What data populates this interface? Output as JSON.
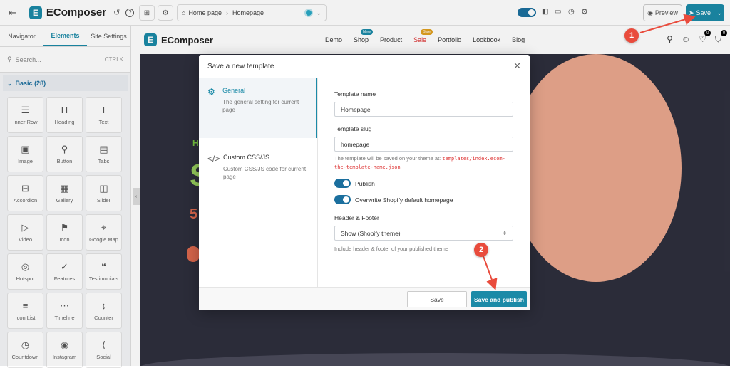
{
  "topbar": {
    "app_name": "EComposer",
    "breadcrumb": [
      "Home page",
      "Homepage"
    ],
    "preview_label": "Preview",
    "save_label": "Save"
  },
  "sidebar": {
    "tabs": [
      "Navigator",
      "Elements",
      "Site Settings"
    ],
    "search_placeholder": "Search...",
    "search_shortcut": "CTRLK",
    "section_title": "Basic (28)",
    "elements": [
      {
        "label": "Inner Row",
        "icon": "inner-row-icon",
        "glyph": "☰"
      },
      {
        "label": "Heading",
        "icon": "heading-icon",
        "glyph": "H"
      },
      {
        "label": "Text",
        "icon": "text-icon",
        "glyph": "T"
      },
      {
        "label": "Image",
        "icon": "image-icon",
        "glyph": "▣"
      },
      {
        "label": "Button",
        "icon": "button-icon",
        "glyph": "⚲"
      },
      {
        "label": "Tabs",
        "icon": "tabs-icon",
        "glyph": "▤"
      },
      {
        "label": "Accordion",
        "icon": "accordion-icon",
        "glyph": "⊟"
      },
      {
        "label": "Gallery",
        "icon": "gallery-icon",
        "glyph": "▦"
      },
      {
        "label": "Slider",
        "icon": "slider-icon",
        "glyph": "◫"
      },
      {
        "label": "Video",
        "icon": "video-icon",
        "glyph": "▷"
      },
      {
        "label": "Icon",
        "icon": "flag-icon",
        "glyph": "⚑"
      },
      {
        "label": "Google Map",
        "icon": "map-icon",
        "glyph": "⌖"
      },
      {
        "label": "Hotspot",
        "icon": "hotspot-icon",
        "glyph": "◎"
      },
      {
        "label": "Features",
        "icon": "features-icon",
        "glyph": "✓"
      },
      {
        "label": "Testimonials",
        "icon": "testimonials-icon",
        "glyph": "❝"
      },
      {
        "label": "Icon List",
        "icon": "icon-list-icon",
        "glyph": "≡"
      },
      {
        "label": "Timeline",
        "icon": "timeline-icon",
        "glyph": "⋯"
      },
      {
        "label": "Counter",
        "icon": "counter-icon",
        "glyph": "↕"
      },
      {
        "label": "Countdown",
        "icon": "countdown-icon",
        "glyph": "◷"
      },
      {
        "label": "Instagram",
        "icon": "instagram-icon",
        "glyph": "◉"
      },
      {
        "label": "Social",
        "icon": "social-icon",
        "glyph": "⟨"
      }
    ]
  },
  "site": {
    "brand": "EComposer",
    "nav": [
      {
        "label": "Demo",
        "badge": ""
      },
      {
        "label": "Shop",
        "badge": "New"
      },
      {
        "label": "Product",
        "badge": ""
      },
      {
        "label": "Sale",
        "badge": "Sale"
      },
      {
        "label": "Portfolio",
        "badge": ""
      },
      {
        "label": "Lookbook",
        "badge": ""
      },
      {
        "label": "Blog",
        "badge": ""
      }
    ],
    "cart_count": "0",
    "wishlist_count": "0",
    "hero_line1": "H",
    "hero_line2": "S",
    "hero_line3": "5"
  },
  "modal": {
    "title": "Save a new template",
    "nav": [
      {
        "title": "General",
        "desc": "The general setting for current page"
      },
      {
        "title": "Custom CSS/JS",
        "desc": "Custom CSS/JS code for current page"
      }
    ],
    "template_name_label": "Template name",
    "template_name_value": "Homepage",
    "template_slug_label": "Template slug",
    "template_slug_value": "homepage",
    "hint_prefix": "The template will be saved on your theme at: ",
    "hint_path": "templates/index.ecom-the-template-name.json",
    "publish_label": "Publish",
    "overwrite_label": "Overwrite Shopify default homepage",
    "header_footer_label": "Header & Footer",
    "header_footer_value": "Show (Shopify theme)",
    "header_footer_hint": "Include header & footer of your published theme",
    "save_button": "Save",
    "publish_button": "Save and publish"
  },
  "annotations": {
    "marker1": "1",
    "marker2": "2",
    "color": "#e94b3c"
  },
  "colors": {
    "accent": "#1b8aa7",
    "toggle": "#1b6f9e"
  }
}
